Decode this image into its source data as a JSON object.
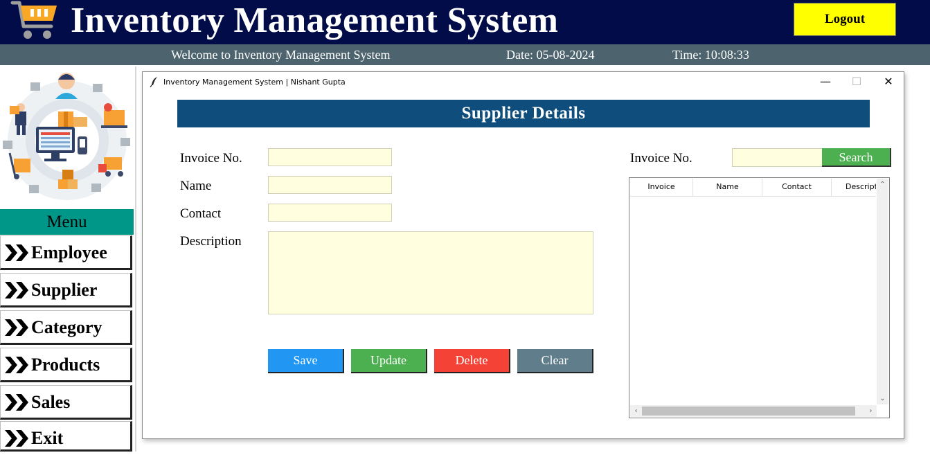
{
  "header": {
    "title": "Inventory Management System",
    "logout_label": "Logout",
    "welcome": "Welcome to Inventory Management System",
    "date": "Date: 05-08-2024",
    "time": "Time: 10:08:33"
  },
  "sidebar": {
    "menu_title": "Menu",
    "items": [
      {
        "label": "Employee"
      },
      {
        "label": "Supplier"
      },
      {
        "label": "Category"
      },
      {
        "label": "Products"
      },
      {
        "label": "Sales"
      },
      {
        "label": "Exit"
      }
    ]
  },
  "window": {
    "title": "Inventory Management System | Nishant Gupta",
    "minimize": "—",
    "maximize": "☐",
    "close": "✕"
  },
  "form": {
    "heading": "Supplier Details",
    "invoice_label": "Invoice No.",
    "name_label": "Name",
    "contact_label": "Contact",
    "description_label": "Description",
    "invoice_value": "",
    "name_value": "",
    "contact_value": "",
    "description_value": ""
  },
  "buttons": {
    "save": "Save",
    "update": "Update",
    "delete": "Delete",
    "clear": "Clear"
  },
  "search": {
    "label": "Invoice No.",
    "value": "",
    "button": "Search"
  },
  "table": {
    "columns": [
      "Invoice",
      "Name",
      "Contact",
      "Descripti"
    ],
    "rows": []
  },
  "colors": {
    "header_bg": "#010c48",
    "subbar_bg": "#4d636d",
    "logout_bg": "#ffff00",
    "menu_label_bg": "#009688",
    "heading_bg": "#0f4d7d",
    "field_bg": "#ffffe0",
    "save": "#2196f3",
    "update": "#4caf50",
    "delete": "#f44336",
    "clear": "#607d8b"
  }
}
